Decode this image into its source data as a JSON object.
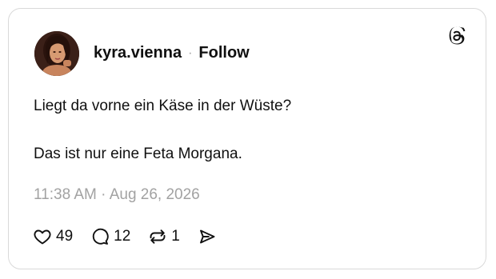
{
  "post": {
    "username": "kyra.vienna",
    "separator": "·",
    "follow_label": "Follow",
    "lines": [
      "Liegt da vorne ein Käse in der Wüste?",
      "Das ist nur eine Feta Morgana."
    ],
    "timestamp": "11:38 AM · Aug 26, 2026",
    "stats": {
      "likes": "49",
      "replies": "12",
      "reposts": "1"
    }
  },
  "icons": {
    "brand": "threads-logo-icon",
    "like": "heart-icon",
    "reply": "reply-bubble-icon",
    "repost": "repost-icon",
    "share": "send-icon"
  },
  "colors": {
    "text": "#101010",
    "muted": "#a2a2a2",
    "border": "#d9d9d9"
  }
}
